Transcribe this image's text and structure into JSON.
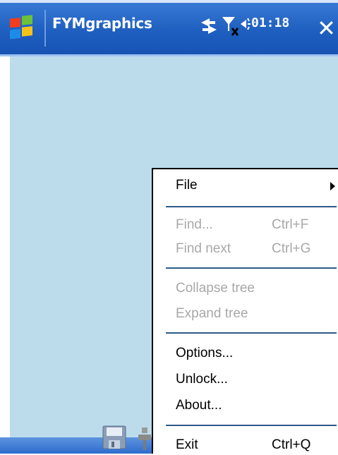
{
  "titlebar": {
    "app_name": "FYMgraphics",
    "time": "01:18",
    "close_label": "✕"
  },
  "menu": {
    "file": "File",
    "find": "Find...",
    "find_shortcut": "Ctrl+F",
    "find_next": "Find next",
    "find_next_shortcut": "Ctrl+G",
    "collapse_tree": "Collapse tree",
    "expand_tree": "Expand tree",
    "options": "Options...",
    "unlock": "Unlock...",
    "about": "About...",
    "exit": "Exit",
    "exit_shortcut": "Ctrl+Q"
  },
  "colors": {
    "titlebar": "#1e5fbf",
    "content": "#bcdcec",
    "disabled_text": "#a8a8a8"
  },
  "icons": [
    "windows-start-icon",
    "connectivity-icon",
    "signal-off-icon",
    "volume-icon",
    "close-icon",
    "save-icon",
    "tree-icon",
    "submenu-arrow-icon"
  ]
}
